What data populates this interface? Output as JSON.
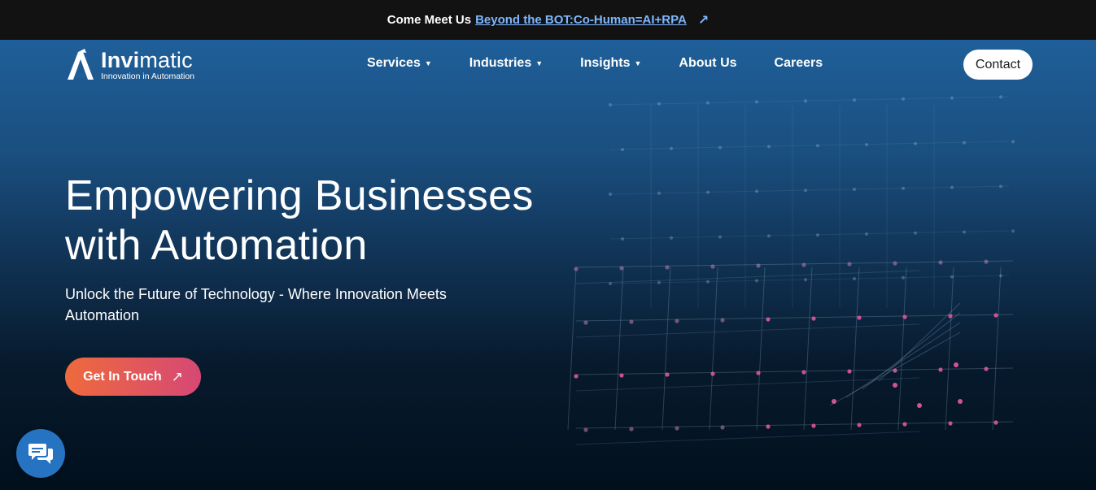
{
  "announcement": {
    "prefix": "Come Meet Us",
    "link_text": "Beyond the BOT:Co-Human=AI+RPA",
    "arrow_icon": "arrow-up-right-icon"
  },
  "brand": {
    "name_bold": "Invi",
    "name_regular": "matic",
    "tagline": "Innovation in Automation"
  },
  "nav": {
    "items": [
      {
        "label": "Services",
        "dropdown": true
      },
      {
        "label": "Industries",
        "dropdown": true
      },
      {
        "label": "Insights",
        "dropdown": true
      },
      {
        "label": "About Us",
        "dropdown": false
      },
      {
        "label": "Careers",
        "dropdown": false
      }
    ],
    "contact_label": "Contact"
  },
  "hero": {
    "title_line1": "Empowering Businesses",
    "title_line2": "with Automation",
    "subtitle": "Unlock the Future of Technology - Where Innovation Meets Automation",
    "cta_label": "Get In Touch",
    "cta_icon": "arrow-up-right-icon"
  },
  "chat": {
    "icon": "chat-bubbles-icon"
  },
  "colors": {
    "accent_link": "#7db7ff",
    "cta_start": "#ee6a3c",
    "cta_end": "#d64875",
    "chat_button": "#2673c2",
    "node_pink": "#e0559e"
  }
}
